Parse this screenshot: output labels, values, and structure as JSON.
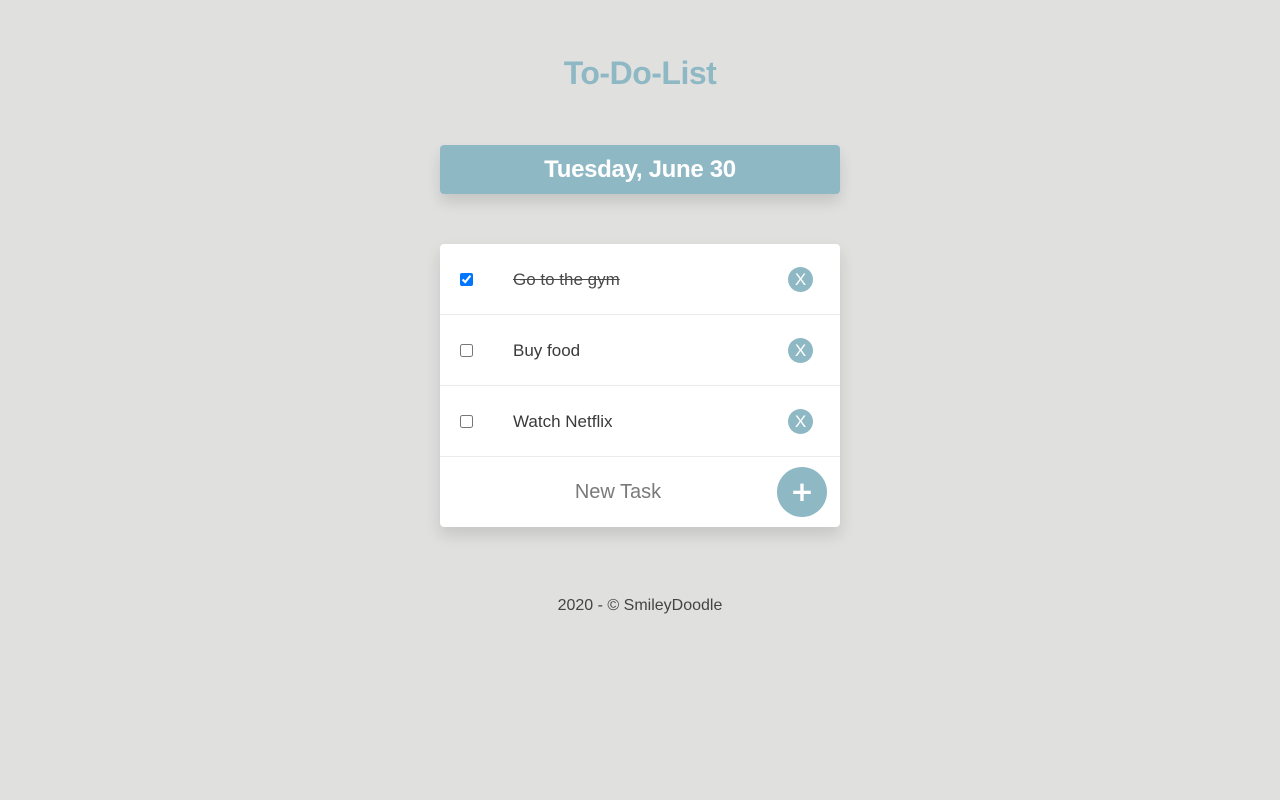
{
  "app": {
    "title": "To-Do-List",
    "date": "Tuesday, June 30"
  },
  "tasks": [
    {
      "text": "Go to the gym",
      "done": true,
      "delete_label": "X"
    },
    {
      "text": "Buy food",
      "done": false,
      "delete_label": "X"
    },
    {
      "text": "Watch Netflix",
      "done": false,
      "delete_label": "X"
    }
  ],
  "new_task": {
    "placeholder": "New Task",
    "value": "",
    "add_label": "+"
  },
  "footer": {
    "text": "2020 - © SmileyDoodle"
  },
  "colors": {
    "background": "#e0e0df",
    "accent": "#8fb8c5",
    "card": "#ffffff"
  }
}
